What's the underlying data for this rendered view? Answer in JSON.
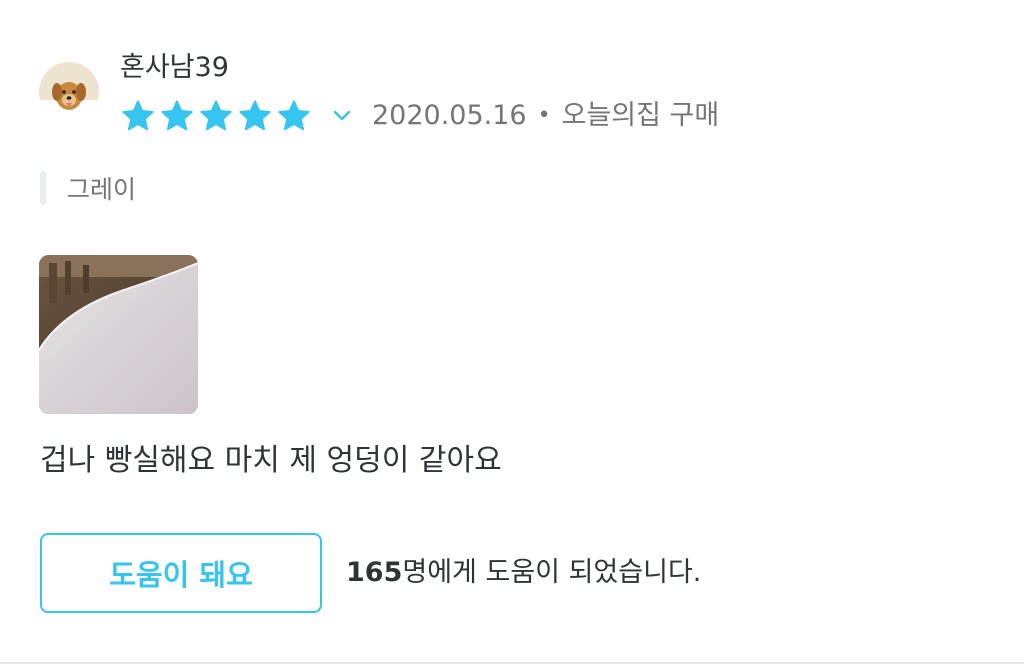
{
  "review": {
    "author": "혼사남39",
    "avatar_icon": "dog-photo-avatar",
    "rating": 5,
    "rating_max": 5,
    "star_color": "#35c5f0",
    "date": "2020.05.16",
    "separator": "•",
    "source": "오늘의집 구매",
    "option": "그레이",
    "photo": "pillow-photo",
    "body": "겁나 빵실해요 마치 제 엉덩이 같아요"
  },
  "helpful": {
    "button_label": "도움이 돼요",
    "count": "165",
    "count_suffix": "명에게 도움이 되었습니다.",
    "accent_color": "#35c5f0"
  }
}
